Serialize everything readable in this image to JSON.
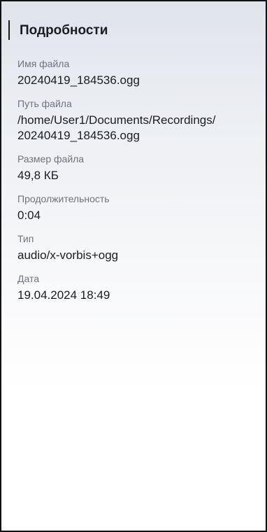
{
  "header": {
    "title": "Подробности"
  },
  "details": {
    "file_name": {
      "label": "Имя файла",
      "value": "20240419_184536.ogg"
    },
    "file_path": {
      "label": "Путь файла",
      "value_lines": [
        "/home/User1/Documents/Recordings/",
        "20240419_184536.ogg"
      ]
    },
    "file_size": {
      "label": "Размер файла",
      "value": "49,8 КБ"
    },
    "duration": {
      "label": "Продолжительность",
      "value": "0:04"
    },
    "type": {
      "label": "Тип",
      "value": "audio/x-vorbis+ogg"
    },
    "date": {
      "label": "Дата",
      "value": "19.04.2024 18:49"
    }
  }
}
